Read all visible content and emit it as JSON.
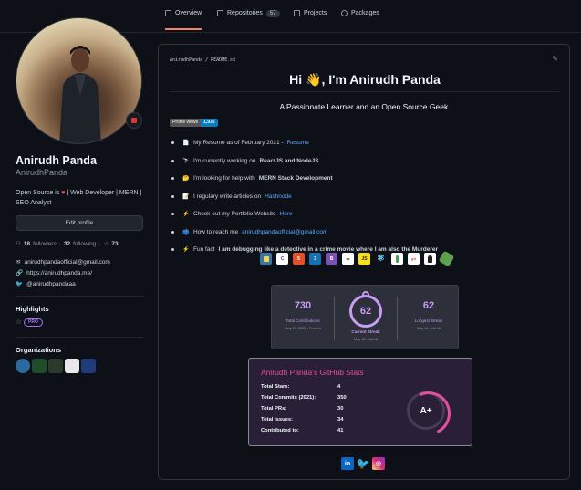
{
  "tabs": [
    {
      "label": "Overview",
      "icon": "book-icon",
      "active": true
    },
    {
      "label": "Repositories",
      "icon": "repo-icon",
      "count": "57"
    },
    {
      "label": "Projects",
      "icon": "project-icon"
    },
    {
      "label": "Packages",
      "icon": "package-icon"
    }
  ],
  "profile": {
    "name": "Anirudh Panda",
    "login": "AnirudhPanda",
    "bio_part1": "Open Source is",
    "bio_part2": "| Web Developer | MERN | SEO Analyst",
    "edit_label": "Edit profile",
    "followers": "18",
    "followers_label": "followers",
    "following": "32",
    "following_label": "following",
    "stars": "73",
    "email": "anirudhpandaofficial@gmail.com",
    "website": "https://anirudhpanda.me/",
    "twitter": "@anirudhpandaaa"
  },
  "highlights": {
    "title": "Highlights",
    "badge": "PRO"
  },
  "organizations": {
    "title": "Organizations",
    "colors": [
      "#2b6a9e",
      "#1f4d2a",
      "#2b3b2b",
      "#e8e8e8",
      "#1f3b7a"
    ]
  },
  "readme": {
    "owner": "AnirudhPanda",
    "slash": " / ",
    "file": "README",
    "ext": ".md",
    "heading": "Hi 👋, I'm Anirudh Panda",
    "tagline": "A Passionate Learner and an Open Source Geek.",
    "views_label": "Profile views",
    "views_count": "1,936",
    "bullets": [
      {
        "emoji": "📄",
        "text": "My Resume as of February 2021 - ",
        "link": "Resume"
      },
      {
        "emoji": "🔭",
        "text": "I'm currently working on ",
        "bold": "ReactJS and NodeJS"
      },
      {
        "emoji": "🤔",
        "text": "I'm looking for help with ",
        "bold": "MERN Stack Development"
      },
      {
        "emoji": "📝",
        "text": "I regulary write articles on ",
        "link": "Hashnode"
      },
      {
        "emoji": "⚡",
        "text": "Check out my Portfolio Website ",
        "link": "Here"
      },
      {
        "emoji": "📫",
        "text": "How to reach me ",
        "link": "anirudhpandaofficial@gmail.com"
      },
      {
        "emoji": "⚡",
        "text": "Fun fact ",
        "bold": "I am debugging like a detective in a crime movie where I am also the Murderer"
      }
    ],
    "tech_icons": [
      {
        "name": "python-icon",
        "color": "#3776ab",
        "glyph": ""
      },
      {
        "name": "c-icon",
        "color": "#ffffff",
        "glyph": "C"
      },
      {
        "name": "html5-icon",
        "color": "#e34f26",
        "glyph": "5"
      },
      {
        "name": "css3-icon",
        "color": "#1572b6",
        "glyph": "3"
      },
      {
        "name": "bootstrap-icon",
        "color": "#7952b3",
        "glyph": "B"
      },
      {
        "name": "express-icon",
        "color": "#ffffff",
        "glyph": ""
      },
      {
        "name": "javascript-icon",
        "color": "#f7df1e",
        "glyph": "JS"
      },
      {
        "name": "react-icon",
        "color": "#0d1117",
        "glyph": "⚛"
      },
      {
        "name": "mongodb-icon",
        "color": "#ffffff",
        "glyph": ""
      },
      {
        "name": "git-icon",
        "color": "#ffffff",
        "glyph": ""
      },
      {
        "name": "linux-icon",
        "color": "#ffffff",
        "glyph": ""
      },
      {
        "name": "nodejs-icon",
        "color": "#5fa04e",
        "glyph": ""
      }
    ],
    "streak": {
      "total": "730",
      "total_label": "Total Contributions",
      "total_range": "May 28, 2020 - Present",
      "current": "62",
      "current_label": "Current Streak",
      "current_range": "May 16 - Jul 16",
      "longest": "62",
      "longest_label": "Longest Streak",
      "longest_range": "May 16 - Jul 16"
    },
    "stats": {
      "title": "Anirudh Panda's GitHub Stats",
      "rows": [
        {
          "label": "Total Stars:",
          "value": "4"
        },
        {
          "label": "Total Commits (2021):",
          "value": "350"
        },
        {
          "label": "Total PRs:",
          "value": "30"
        },
        {
          "label": "Total Issues:",
          "value": "34"
        },
        {
          "label": "Contributed to:",
          "value": "41"
        }
      ],
      "grade": "A+"
    },
    "social": [
      {
        "name": "linkedin-icon",
        "color": "#0a66c2",
        "glyph": "in"
      },
      {
        "name": "twitter-icon",
        "color": "#1d9bf0",
        "glyph": "t"
      },
      {
        "name": "instagram-icon",
        "color": "#d62976",
        "glyph": "◎"
      }
    ]
  }
}
